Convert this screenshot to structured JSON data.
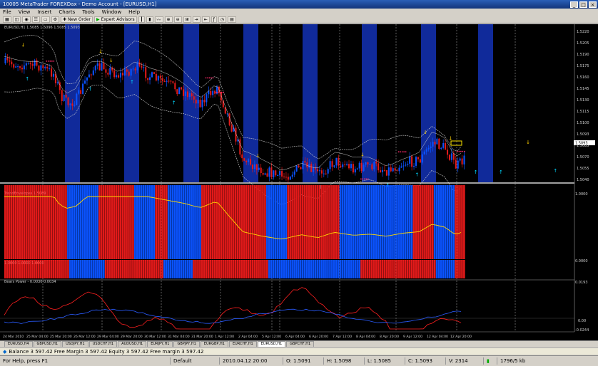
{
  "window": {
    "title": "10005 MetaTrader FOREXDax - Demo Account - [EURUSD,H1]",
    "min": "_",
    "max": "□",
    "close": "×"
  },
  "menu": [
    "File",
    "View",
    "Insert",
    "Charts",
    "Tools",
    "Window",
    "Help"
  ],
  "toolbar": {
    "new_order": "New Order",
    "expert_advisors": "Expert Advisors"
  },
  "chart": {
    "title": "EURUSD,H1 1.5085 1.5096 1.5085 1.5093",
    "bg": "#000000",
    "session_band_color": "#102a9a",
    "bull_color": "#0b53ff",
    "bear_color": "#e21a1a",
    "band_line_color": "#cfcfcf",
    "ma_color": "#ffd800",
    "buy_arrow_color": "#ffd200",
    "sell_arrow_color": "#00d8ff",
    "marker_color": "#ff2a6a",
    "price_ticks": [
      "1.5220",
      "1.5205",
      "1.5190",
      "1.5175",
      "1.5160",
      "1.5145",
      "1.5130",
      "1.5115",
      "1.5100",
      "1.5093",
      "1.5085",
      "1.5070",
      "1.5055",
      "1.5040"
    ],
    "current_price": "1.5093",
    "indicator1_label": "TrendEnvelopes 1.5089",
    "indicator1_right_top": "1.0000",
    "indicator1_right_bottom": "0.0000",
    "indicator2_label": "1.0000 1.0000 1.0000",
    "indicator3_label": "Bears Power - 0.0030 0.0034",
    "indicator3_right_top": "0.0193",
    "indicator3_zero": "0.00",
    "indicator3_right_bottom": "-0.0244",
    "time_labels": [
      "24 Mar 2010",
      "25 Mar 04:00",
      "25 Mar 20:00",
      "26 Mar 12:00",
      "29 Mar 04:00",
      "29 Mar 20:00",
      "30 Mar 12:00",
      "31 Mar 04:00",
      "31 Mar 20:00",
      "1 Apr 12:00",
      "2 Apr 04:00",
      "5 Apr 12:00",
      "6 Apr 04:00",
      "6 Apr 20:00",
      "7 Apr 12:00",
      "8 Apr 04:00",
      "8 Apr 20:00",
      "9 Apr 12:00",
      "12 Apr 04:00",
      "12 Apr 20:00"
    ]
  },
  "tabs": [
    "EURUSD,H4",
    "GBPUSD,H1",
    "USDJPY,H1",
    "USDCHF,H1",
    "AUDUSD,H1",
    "EURJPY,H1",
    "GBPJPY,H1",
    "EURGBP,H1",
    "EURCHF,H1",
    "EURUSD,H1",
    "GBPCHF,H1"
  ],
  "active_tab_index": 9,
  "infobar": {
    "text": "Balance 3 597.42  Free Margin 3 597.42  Equity 3 597.42  Free margin 3 597.42"
  },
  "statusbar": {
    "help": "For Help, press F1",
    "profile": "Default",
    "datetime": "2010.04.12 20:00",
    "open": "O: 1.5091",
    "high": "H: 1.5098",
    "low": "L: 1.5085",
    "close": "C: 1.5093",
    "volume": "V: 2314",
    "traffic": "1796/5 kb"
  }
}
